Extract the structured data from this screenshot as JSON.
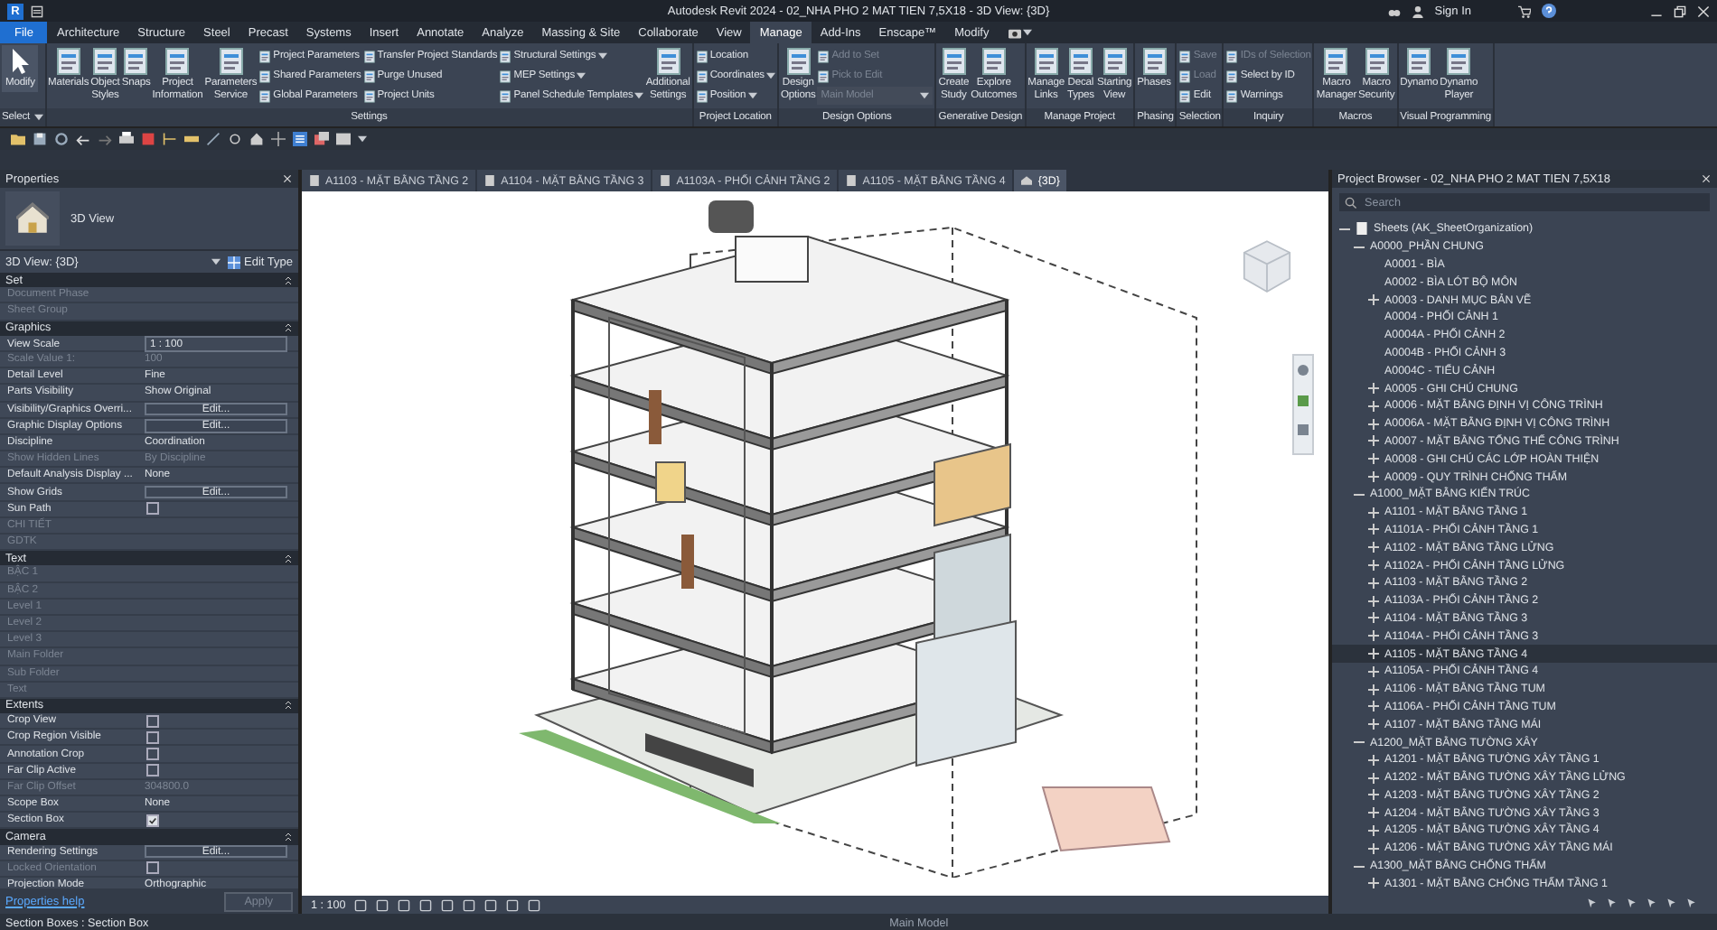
{
  "window": {
    "logo": "R",
    "title": "Autodesk Revit 2024 - 02_NHA PHO 2 MAT TIEN 7,5X18 - 3D View: {3D}",
    "sign_in": "Sign In"
  },
  "ribbon_tabs": [
    {
      "label": "File",
      "kind": "file",
      "selected": false
    },
    {
      "label": "Architecture",
      "kind": "tab",
      "selected": false
    },
    {
      "label": "Structure",
      "kind": "tab",
      "selected": false
    },
    {
      "label": "Steel",
      "kind": "tab",
      "selected": false
    },
    {
      "label": "Precast",
      "kind": "tab",
      "selected": false
    },
    {
      "label": "Systems",
      "kind": "tab",
      "selected": false
    },
    {
      "label": "Insert",
      "kind": "tab",
      "selected": false
    },
    {
      "label": "Annotate",
      "kind": "tab",
      "selected": false
    },
    {
      "label": "Analyze",
      "kind": "tab",
      "selected": false
    },
    {
      "label": "Massing & Site",
      "kind": "tab",
      "selected": false
    },
    {
      "label": "Collaborate",
      "kind": "tab",
      "selected": false
    },
    {
      "label": "View",
      "kind": "tab",
      "selected": false
    },
    {
      "label": "Manage",
      "kind": "tab",
      "selected": true
    },
    {
      "label": "Add-Ins",
      "kind": "tab",
      "selected": false
    },
    {
      "label": "Enscape™",
      "kind": "tab",
      "selected": false
    },
    {
      "label": "Modify",
      "kind": "tab",
      "selected": false
    }
  ],
  "ribbon_panels": [
    {
      "label": "Select",
      "dropdown": true,
      "items": [
        {
          "kind": "pointer",
          "label": "Modify"
        }
      ]
    },
    {
      "label": "Settings",
      "dropdown": false,
      "items": [
        {
          "kind": "large",
          "label": "Materials"
        },
        {
          "kind": "large",
          "label": "Object\nStyles"
        },
        {
          "kind": "large",
          "label": "Snaps"
        },
        {
          "kind": "large",
          "label": "Project\nInformation"
        },
        {
          "kind": "large",
          "label": "Parameters\nService"
        },
        {
          "kind": "stack",
          "entries": [
            {
              "label": "Project  Parameters",
              "disabled": false,
              "dropdown": false
            },
            {
              "label": "Shared  Parameters",
              "disabled": false,
              "dropdown": false
            },
            {
              "label": "Global  Parameters",
              "disabled": false,
              "dropdown": false
            }
          ]
        },
        {
          "kind": "stack",
          "entries": [
            {
              "label": "Transfer  Project Standards",
              "disabled": false,
              "dropdown": false
            },
            {
              "label": "Purge  Unused",
              "disabled": false,
              "dropdown": false
            },
            {
              "label": "Project  Units",
              "disabled": false,
              "dropdown": false
            }
          ]
        },
        {
          "kind": "stack",
          "entries": [
            {
              "label": "Structural  Settings",
              "disabled": false,
              "dropdown": true
            },
            {
              "label": "MEP  Settings",
              "disabled": false,
              "dropdown": true
            },
            {
              "label": "Panel Schedule  Templates",
              "disabled": false,
              "dropdown": true
            }
          ]
        },
        {
          "kind": "large",
          "label": "Additional\nSettings"
        }
      ]
    },
    {
      "label": "Project Location",
      "dropdown": false,
      "items": [
        {
          "kind": "stack",
          "entries": [
            {
              "label": "Location",
              "disabled": false,
              "dropdown": false
            },
            {
              "label": "Coordinates",
              "disabled": false,
              "dropdown": true
            },
            {
              "label": "Position",
              "disabled": false,
              "dropdown": true
            }
          ]
        }
      ]
    },
    {
      "label": "Design Options",
      "dropdown": false,
      "items": [
        {
          "kind": "large",
          "label": "Design\nOptions"
        },
        {
          "kind": "stack",
          "entries": [
            {
              "label": "Add to Set",
              "disabled": true,
              "dropdown": false
            },
            {
              "label": "Pick to Edit",
              "disabled": true,
              "dropdown": false
            },
            {
              "label": "Main Model",
              "disabled": true,
              "dropdown": true,
              "kind": "combo"
            }
          ]
        }
      ]
    },
    {
      "label": "Generative Design",
      "dropdown": false,
      "items": [
        {
          "kind": "large",
          "label": "Create\nStudy"
        },
        {
          "kind": "large",
          "label": "Explore\nOutcomes"
        }
      ]
    },
    {
      "label": "Manage Project",
      "dropdown": false,
      "items": [
        {
          "kind": "large",
          "label": "Manage\nLinks"
        },
        {
          "kind": "large",
          "label": "Decal\nTypes"
        },
        {
          "kind": "large",
          "label": "Starting\nView"
        }
      ]
    },
    {
      "label": "Phasing",
      "dropdown": false,
      "items": [
        {
          "kind": "large",
          "label": "Phases"
        }
      ]
    },
    {
      "label": "Selection",
      "dropdown": false,
      "items": [
        {
          "kind": "stack",
          "entries": [
            {
              "label": "Save",
              "disabled": true,
              "dropdown": false
            },
            {
              "label": "Load",
              "disabled": true,
              "dropdown": false
            },
            {
              "label": "Edit",
              "disabled": false,
              "dropdown": false
            }
          ]
        }
      ]
    },
    {
      "label": "Inquiry",
      "dropdown": false,
      "items": [
        {
          "kind": "stack",
          "entries": [
            {
              "label": "IDs of  Selection",
              "disabled": true,
              "dropdown": false
            },
            {
              "label": "Select  by ID",
              "disabled": false,
              "dropdown": false
            },
            {
              "label": "Warnings",
              "disabled": false,
              "dropdown": false
            }
          ]
        }
      ]
    },
    {
      "label": "Macros",
      "dropdown": false,
      "items": [
        {
          "kind": "large",
          "label": "Macro\nManager"
        },
        {
          "kind": "large",
          "label": "Macro\nSecurity"
        }
      ]
    },
    {
      "label": "Visual Programming",
      "dropdown": false,
      "items": [
        {
          "kind": "large",
          "label": "Dynamo"
        },
        {
          "kind": "large",
          "label": "Dynamo\nPlayer"
        }
      ]
    }
  ],
  "properties": {
    "title": "Properties",
    "type_name": "3D View",
    "type_selector": "3D View: {3D}",
    "edit_type": "Edit Type",
    "sections": [
      {
        "title": "Set",
        "rows": [
          {
            "label": "Document Phase",
            "kind": "text",
            "value": "",
            "disabled": true
          },
          {
            "label": "Sheet Group",
            "kind": "text",
            "disabled": true
          }
        ]
      },
      {
        "title": "Graphics",
        "rows": [
          {
            "label": "View Scale",
            "kind": "field",
            "value": "1 : 100",
            "disabled": false
          },
          {
            "label": "Scale Value    1:",
            "kind": "text",
            "value": "100",
            "disabled": true
          },
          {
            "label": "Detail Level",
            "kind": "text",
            "value": "Fine",
            "disabled": false
          },
          {
            "label": "Parts Visibility",
            "kind": "text",
            "value": "Show Original",
            "disabled": false
          },
          {
            "label": "Visibility/Graphics Overri...",
            "kind": "button",
            "value": "Edit...",
            "disabled": false
          },
          {
            "label": "Graphic Display Options",
            "kind": "button",
            "value": "Edit...",
            "disabled": false
          },
          {
            "label": "Discipline",
            "kind": "text",
            "value": "Coordination",
            "disabled": false
          },
          {
            "label": "Show Hidden Lines",
            "kind": "text",
            "value": "By Discipline",
            "disabled": true
          },
          {
            "label": "Default Analysis Display ...",
            "kind": "text",
            "value": "None",
            "disabled": false
          },
          {
            "label": "Show Grids",
            "kind": "button",
            "value": "Edit...",
            "disabled": false
          },
          {
            "label": "Sun Path",
            "kind": "checkbox",
            "checked": false,
            "disabled": false
          },
          {
            "label": "CHI TIẾT",
            "kind": "text",
            "disabled": true
          },
          {
            "label": "GDTK",
            "kind": "text",
            "disabled": true
          }
        ]
      },
      {
        "title": "Text",
        "rows": [
          {
            "label": "BẬC 1",
            "kind": "text",
            "disabled": true
          },
          {
            "label": "BẬC 2",
            "kind": "text",
            "disabled": true
          },
          {
            "label": "Level 1",
            "kind": "text",
            "disabled": true
          },
          {
            "label": "Level 2",
            "kind": "text",
            "disabled": true
          },
          {
            "label": "Level 3",
            "kind": "text",
            "disabled": true
          },
          {
            "label": "Main Folder",
            "kind": "text",
            "disabled": true
          },
          {
            "label": "Sub Folder",
            "kind": "text",
            "disabled": true
          },
          {
            "label": "Text",
            "kind": "text",
            "disabled": true
          }
        ]
      },
      {
        "title": "Extents",
        "rows": [
          {
            "label": "Crop View",
            "kind": "checkbox",
            "checked": false,
            "disabled": false
          },
          {
            "label": "Crop Region Visible",
            "kind": "checkbox",
            "checked": false,
            "disabled": false
          },
          {
            "label": "Annotation Crop",
            "kind": "checkbox",
            "checked": false,
            "disabled": false
          },
          {
            "label": "Far Clip Active",
            "kind": "checkbox",
            "checked": false,
            "disabled": false
          },
          {
            "label": "Far Clip Offset",
            "kind": "text",
            "value": "304800.0",
            "disabled": true
          },
          {
            "label": "Scope Box",
            "kind": "text",
            "value": "None",
            "disabled": false
          },
          {
            "label": "Section Box",
            "kind": "checkbox",
            "checked": true,
            "disabled": false
          }
        ]
      },
      {
        "title": "Camera",
        "rows": [
          {
            "label": "Rendering Settings",
            "kind": "button",
            "value": "Edit...",
            "disabled": false
          },
          {
            "label": "Locked Orientation",
            "kind": "checkbox",
            "checked": false,
            "disabled": true
          },
          {
            "label": "Projection Mode",
            "kind": "text",
            "value": "Orthographic",
            "disabled": false
          }
        ]
      }
    ],
    "help_link": "Properties help",
    "apply": "Apply",
    "apply_disabled": true
  },
  "view_tabs": [
    {
      "label": "A1103 - MẶT BẰNG TẦNG 2",
      "selected": false
    },
    {
      "label": "A1104 - MẶT BẰNG TẦNG 3",
      "selected": false
    },
    {
      "label": "A1103A - PHỐI CẢNH TẦNG 2",
      "selected": false
    },
    {
      "label": "A1105 - MẶT BẰNG TẦNG 4",
      "selected": false
    },
    {
      "label": "{3D}",
      "selected": true
    }
  ],
  "view_bar": {
    "scale": "1 : 100"
  },
  "project_browser": {
    "title": "Project Browser - 02_NHA PHO 2 MAT TIEN 7,5X18",
    "search": {
      "placeholder": "Search"
    },
    "tree": [
      {
        "label": "Sheets (AK_SheetOrganization)",
        "kind": "expanded",
        "selected": false,
        "children": [
          {
            "label": "A0000_PHẦN CHUNG",
            "kind": "expanded",
            "selected": false,
            "children": [
              {
                "label": "A0001 - BÌA",
                "kind": "leaf",
                "selected": false
              },
              {
                "label": "A0002 - BÌA LÓT BỘ MÔN",
                "kind": "leaf",
                "selected": false
              },
              {
                "label": "A0003 - DANH MỤC BẢN VẼ",
                "kind": "collapsed",
                "selected": false
              },
              {
                "label": "A0004 - PHỐI CẢNH 1",
                "kind": "leaf",
                "selected": false
              },
              {
                "label": "A0004A - PHỐI CẢNH 2",
                "kind": "leaf",
                "selected": false
              },
              {
                "label": "A0004B - PHỐI CẢNH 3",
                "kind": "leaf",
                "selected": false
              },
              {
                "label": "A0004C - TIỂU CẢNH",
                "kind": "leaf",
                "selected": false
              },
              {
                "label": "A0005 - GHI CHÚ CHUNG",
                "kind": "collapsed",
                "selected": false
              },
              {
                "label": "A0006 - MẶT BẰNG ĐỊNH VỊ CÔNG TRÌNH",
                "kind": "collapsed",
                "selected": false
              },
              {
                "label": "A0006A - MẶT BẰNG ĐỊNH VỊ CÔNG TRÌNH",
                "kind": "collapsed",
                "selected": false
              },
              {
                "label": "A0007 - MẶT BẰNG TỔNG THỂ CÔNG TRÌNH",
                "kind": "collapsed",
                "selected": false
              },
              {
                "label": "A0008 - GHI CHÚ CÁC LỚP HOÀN THIỆN",
                "kind": "collapsed",
                "selected": false
              },
              {
                "label": "A0009 - QUY TRÌNH CHỐNG THẤM",
                "kind": "collapsed",
                "selected": false
              }
            ]
          },
          {
            "label": "A1000_MẶT BẰNG KIẾN TRÚC",
            "kind": "expanded",
            "selected": false,
            "children": [
              {
                "label": "A1101 - MẶT BẰNG TẦNG 1",
                "kind": "collapsed",
                "selected": false
              },
              {
                "label": "A1101A - PHỐI CẢNH TẦNG 1",
                "kind": "collapsed",
                "selected": false
              },
              {
                "label": "A1102 - MẶT BẰNG TẦNG LỬNG",
                "kind": "collapsed",
                "selected": false
              },
              {
                "label": "A1102A - PHỐI CẢNH TẦNG LỬNG",
                "kind": "collapsed",
                "selected": false
              },
              {
                "label": "A1103 - MẶT BẰNG TẦNG 2",
                "kind": "collapsed",
                "selected": false
              },
              {
                "label": "A1103A - PHỐI CẢNH TẦNG 2",
                "kind": "collapsed",
                "selected": false
              },
              {
                "label": "A1104 - MẶT BẰNG TẦNG 3",
                "kind": "collapsed",
                "selected": false
              },
              {
                "label": "A1104A - PHỐI CẢNH TẦNG 3",
                "kind": "collapsed",
                "selected": false
              },
              {
                "label": "A1105 - MẶT BẰNG TẦNG 4",
                "kind": "collapsed",
                "selected": true
              },
              {
                "label": "A1105A - PHỐI CẢNH TẦNG 4",
                "kind": "collapsed",
                "selected": false
              },
              {
                "label": "A1106 - MẶT BẰNG TẦNG TUM",
                "kind": "collapsed",
                "selected": false
              },
              {
                "label": "A1106A - PHỐI CẢNH TẦNG TUM",
                "kind": "collapsed",
                "selected": false
              },
              {
                "label": "A1107 - MẶT BẰNG TẦNG MÁI",
                "kind": "collapsed",
                "selected": false
              }
            ]
          },
          {
            "label": "A1200_MẶT BẰNG TƯỜNG XÂY",
            "kind": "expanded",
            "selected": false,
            "children": [
              {
                "label": "A1201 - MẶT BẰNG TƯỜNG XÂY TẦNG 1",
                "kind": "collapsed",
                "selected": false
              },
              {
                "label": "A1202 - MẶT BẰNG TƯỜNG XÂY TẦNG LỬNG",
                "kind": "collapsed",
                "selected": false
              },
              {
                "label": "A1203 - MẶT BẰNG TƯỜNG XÂY TẦNG 2",
                "kind": "collapsed",
                "selected": false
              },
              {
                "label": "A1204 - MẶT BẰNG TƯỜNG XÂY TẦNG 3",
                "kind": "collapsed",
                "selected": false
              },
              {
                "label": "A1205 - MẶT BẰNG TƯỜNG XÂY TẦNG 4",
                "kind": "collapsed",
                "selected": false
              },
              {
                "label": "A1206 - MẶT BẰNG TƯỜNG XÂY TẦNG MÁI",
                "kind": "collapsed",
                "selected": false
              }
            ]
          },
          {
            "label": "A1300_MẶT BẰNG CHỐNG THẤM",
            "kind": "expanded",
            "selected": false,
            "children": [
              {
                "label": "A1301 - MẶT BẰNG CHỐNG THẤM TẦNG 1",
                "kind": "collapsed",
                "selected": false
              }
            ]
          }
        ]
      }
    ]
  },
  "status_bar": {
    "message": "Section Boxes : Section Box",
    "model": "Main Model"
  }
}
